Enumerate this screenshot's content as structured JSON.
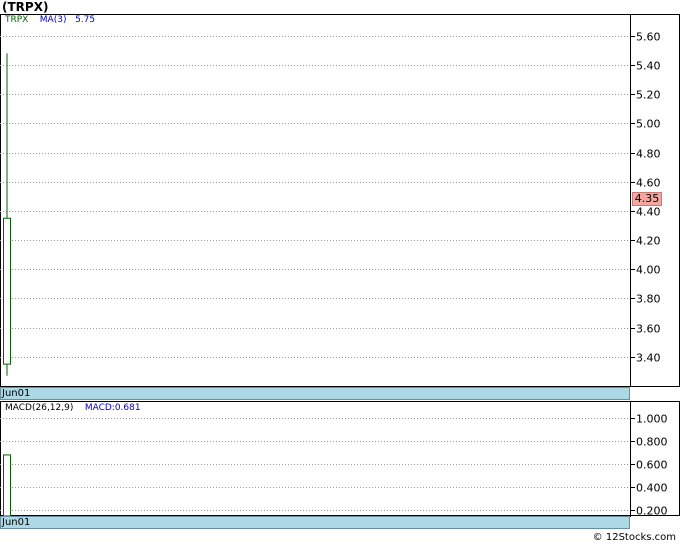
{
  "title": "(TRPX)",
  "credit": "© 12Stocks.com",
  "price_panel": {
    "legend": {
      "symbol": "TRPX",
      "ma_label": "MA(3)",
      "ma_value": "5.75"
    },
    "current_value": "4.35",
    "date_label": "Jun01",
    "colors": {
      "candle": "#006400",
      "grid": "#999999",
      "badge": "#f4a6a0",
      "ma": "#0000cc"
    }
  },
  "macd_panel": {
    "legend": {
      "label": "MACD(26,12,9)",
      "value_label": "MACD:0.681"
    },
    "date_label": "Jun01"
  },
  "chart_data": [
    {
      "type": "candlestick",
      "title": "(TRPX)",
      "x": [
        "Jun01"
      ],
      "open": [
        3.35
      ],
      "high": [
        5.48
      ],
      "low": [
        3.27
      ],
      "close": [
        4.35
      ],
      "ylim": [
        3.2,
        5.75
      ],
      "yticks": [
        3.4,
        3.6,
        3.8,
        4.0,
        4.2,
        4.4,
        4.6,
        4.8,
        5.0,
        5.2,
        5.4,
        5.6
      ],
      "ytick_labels": [
        "3.40",
        "3.60",
        "3.80",
        "4.00",
        "4.20",
        "4.40",
        "4.60",
        "4.80",
        "5.00",
        "5.20",
        "5.40",
        "5.60"
      ],
      "grid": true
    },
    {
      "type": "bar",
      "title": "MACD(26,12,9)",
      "x": [
        "Jun01"
      ],
      "values": [
        0.681
      ],
      "ylim": [
        0.15,
        1.15
      ],
      "yticks": [
        0.2,
        0.4,
        0.6,
        0.8,
        1.0
      ],
      "ytick_labels": [
        "0.200",
        "0.400",
        "0.600",
        "0.800",
        "1.000"
      ],
      "grid": true
    }
  ]
}
